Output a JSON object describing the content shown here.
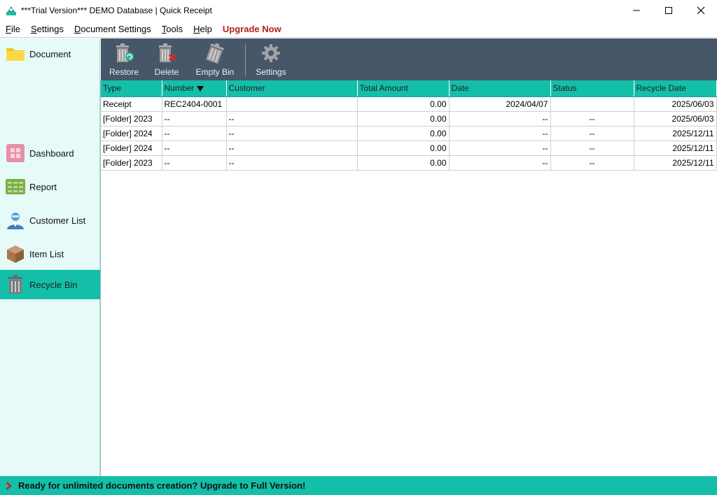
{
  "window": {
    "title": "***Trial Version*** DEMO Database | Quick Receipt",
    "app_icon": "quick-receipt-logo-icon",
    "controls": [
      "minimize-icon",
      "maximize-icon",
      "close-icon"
    ]
  },
  "menubar": {
    "file": {
      "ul": "F",
      "rest": "ile"
    },
    "settings": {
      "ul": "S",
      "rest": "ettings"
    },
    "document_settings": {
      "ul": "D",
      "rest": "ocument Settings"
    },
    "tools": {
      "ul": "T",
      "rest": "ools"
    },
    "help": {
      "ul": "H",
      "rest": "elp"
    },
    "upgrade": "Upgrade Now"
  },
  "sidebar": {
    "items": [
      {
        "label": "Document",
        "icon": "folder-icon"
      },
      {
        "label": "Dashboard",
        "icon": "dashboard-icon"
      },
      {
        "label": "Report",
        "icon": "report-icon"
      },
      {
        "label": "Customer List",
        "icon": "customer-icon"
      },
      {
        "label": "Item List",
        "icon": "box-icon"
      },
      {
        "label": "Recycle Bin",
        "icon": "trash-icon",
        "active": true
      }
    ]
  },
  "toolbar": {
    "restore": "Restore",
    "delete": "Delete",
    "empty_bin": "Empty Bin",
    "settings": "Settings"
  },
  "table": {
    "columns": [
      "Type",
      "Number",
      "Customer",
      "Total Amount",
      "Date",
      "Status",
      "Recycle Date"
    ],
    "sorted_column": "Number",
    "rows": [
      [
        "Receipt",
        "REC2404-0001",
        "",
        "0.00",
        "2024/04/07",
        "",
        "2025/06/03"
      ],
      [
        "[Folder] 2023",
        "--",
        "--",
        "0.00",
        "--",
        "--",
        "2025/06/03"
      ],
      [
        "[Folder] 2024",
        "--",
        "--",
        "0.00",
        "--",
        "--",
        "2025/12/11"
      ],
      [
        "[Folder] 2024",
        "--",
        "--",
        "0.00",
        "--",
        "--",
        "2025/12/11"
      ],
      [
        "[Folder] 2023",
        "--",
        "--",
        "0.00",
        "--",
        "--",
        "2025/12/11"
      ]
    ]
  },
  "footer": {
    "message": "Ready for unlimited documents creation? Upgrade to Full Version!"
  },
  "colors": {
    "accent": "#14bfaa",
    "toolbar": "#46576a",
    "sidebar_bg": "#e6fbf7",
    "upgrade_red": "#b22222"
  }
}
